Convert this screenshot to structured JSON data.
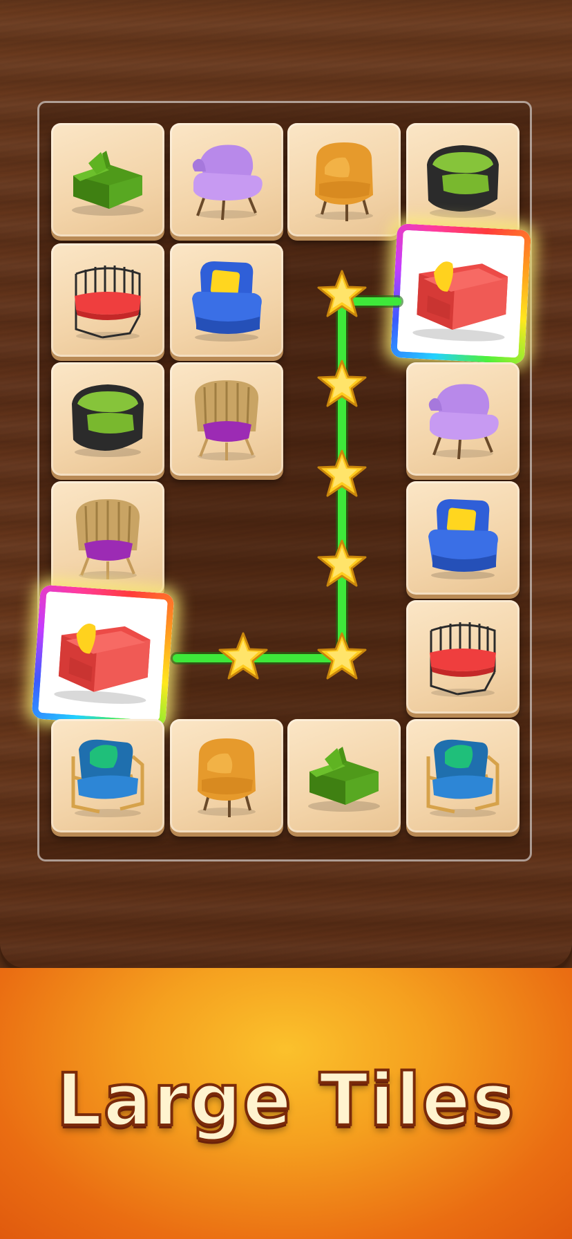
{
  "banner": {
    "title": "Large Tiles"
  },
  "colors": {
    "path": "#3ee83a",
    "star": "#ffcc1f",
    "tile_face": "#f3d4a9",
    "banner": "#f5a01f"
  },
  "board": {
    "columns": 4,
    "rows": 6,
    "tiles": [
      {
        "row": 0,
        "col": 0,
        "item": "green-sectional-sofa"
      },
      {
        "row": 0,
        "col": 1,
        "item": "purple-armchair"
      },
      {
        "row": 0,
        "col": 2,
        "item": "orange-armchair"
      },
      {
        "row": 0,
        "col": 3,
        "item": "green-black-tub-chair"
      },
      {
        "row": 1,
        "col": 0,
        "item": "red-wire-chair"
      },
      {
        "row": 1,
        "col": 1,
        "item": "blue-armchair"
      },
      {
        "row": 1,
        "col": 3,
        "item": "red-loveseat",
        "selected": true
      },
      {
        "row": 2,
        "col": 0,
        "item": "green-black-tub-chair"
      },
      {
        "row": 2,
        "col": 1,
        "item": "shell-back-chair"
      },
      {
        "row": 2,
        "col": 3,
        "item": "purple-armchair"
      },
      {
        "row": 3,
        "col": 0,
        "item": "shell-back-chair"
      },
      {
        "row": 3,
        "col": 3,
        "item": "blue-armchair"
      },
      {
        "row": 4,
        "col": 0,
        "item": "red-loveseat",
        "selected": true
      },
      {
        "row": 4,
        "col": 3,
        "item": "red-wire-chair"
      },
      {
        "row": 5,
        "col": 0,
        "item": "blue-frame-armchair"
      },
      {
        "row": 5,
        "col": 1,
        "item": "orange-armchair"
      },
      {
        "row": 5,
        "col": 2,
        "item": "green-sectional-sofa"
      },
      {
        "row": 5,
        "col": 3,
        "item": "blue-frame-armchair"
      }
    ]
  },
  "match_path": {
    "stars": 6
  }
}
